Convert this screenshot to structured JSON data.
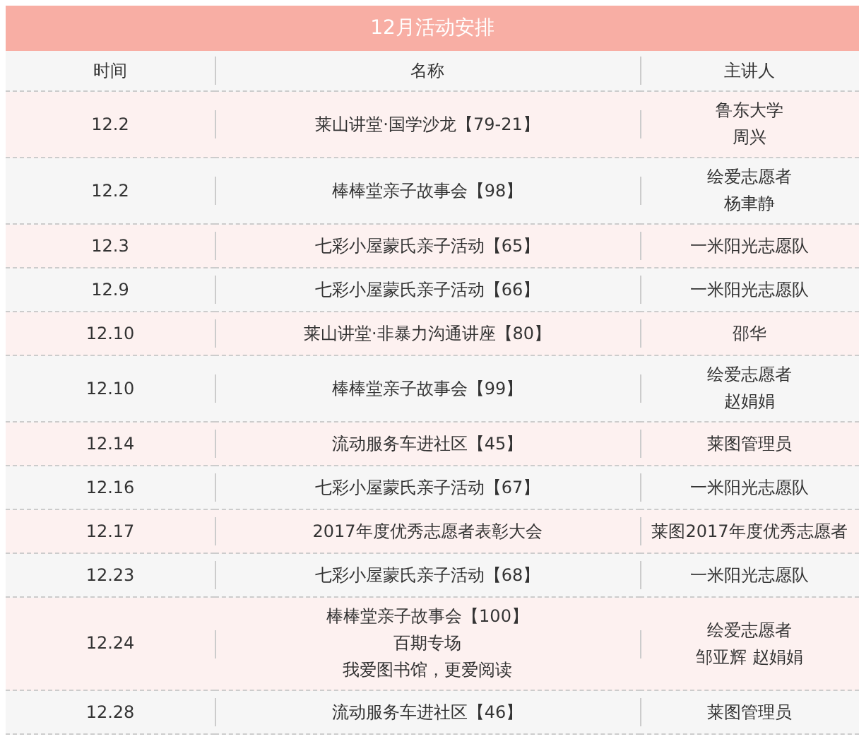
{
  "title": "12月活动安排",
  "columns": [
    "时间",
    "名称",
    "主讲人"
  ],
  "rows": [
    {
      "time": "12.2",
      "name": [
        "莱山讲堂·国学沙龙【79-21】"
      ],
      "speaker": [
        "鲁东大学",
        "周兴"
      ]
    },
    {
      "time": "12.2",
      "name": [
        "棒棒堂亲子故事会【98】"
      ],
      "speaker": [
        "绘爱志愿者",
        "杨聿静"
      ]
    },
    {
      "time": "12.3",
      "name": [
        "七彩小屋蒙氏亲子活动【65】"
      ],
      "speaker": [
        "一米阳光志愿队"
      ]
    },
    {
      "time": "12.9",
      "name": [
        "七彩小屋蒙氏亲子活动【66】"
      ],
      "speaker": [
        "一米阳光志愿队"
      ]
    },
    {
      "time": "12.10",
      "name": [
        "莱山讲堂·非暴力沟通讲座【80】"
      ],
      "speaker": [
        "邵华"
      ]
    },
    {
      "time": "12.10",
      "name": [
        "棒棒堂亲子故事会【99】"
      ],
      "speaker": [
        "绘爱志愿者",
        "赵娟娟"
      ]
    },
    {
      "time": "12.14",
      "name": [
        "流动服务车进社区【45】"
      ],
      "speaker": [
        "莱图管理员"
      ]
    },
    {
      "time": "12.16",
      "name": [
        "七彩小屋蒙氏亲子活动【67】"
      ],
      "speaker": [
        "一米阳光志愿队"
      ]
    },
    {
      "time": "12.17",
      "name": [
        "2017年度优秀志愿者表彰大会"
      ],
      "speaker": [
        "莱图2017年度优秀志愿者"
      ]
    },
    {
      "time": "12.23",
      "name": [
        "七彩小屋蒙氏亲子活动【68】"
      ],
      "speaker": [
        "一米阳光志愿队"
      ]
    },
    {
      "time": "12.24",
      "name": [
        "棒棒堂亲子故事会【100】",
        "百期专场",
        "我爱图书馆，更爱阅读"
      ],
      "speaker": [
        "绘爱志愿者",
        "邹亚辉 赵娟娟"
      ]
    },
    {
      "time": "12.28",
      "name": [
        "流动服务车进社区【46】"
      ],
      "speaker": [
        "莱图管理员"
      ]
    }
  ]
}
